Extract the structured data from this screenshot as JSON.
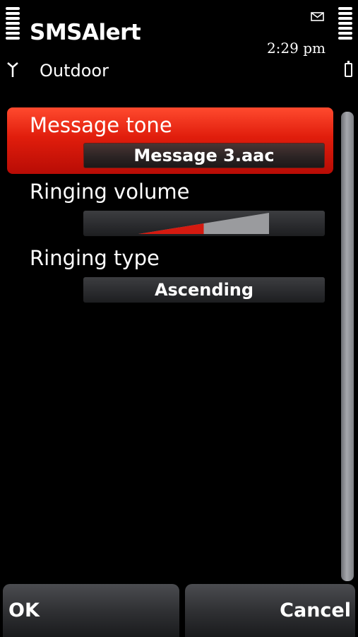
{
  "status_bar": {
    "app_title": "SMSAlert",
    "time": "2:29 pm",
    "profile": "Outdoor",
    "icons": [
      "signal-strength-icon",
      "antenna-icon",
      "envelope-icon",
      "battery-strength-icon",
      "battery-icon"
    ]
  },
  "settings": [
    {
      "label": "Message tone",
      "value": "Message 3.aac",
      "selected": true
    },
    {
      "label": "Ringing volume",
      "volume_level": 0.5
    },
    {
      "label": "Ringing type",
      "value": "Ascending"
    }
  ],
  "softkeys": {
    "left": "OK",
    "right": "Cancel"
  },
  "colors": {
    "highlight": "#e01d0c",
    "background": "#000000",
    "volume_fill": "#d41a10"
  }
}
